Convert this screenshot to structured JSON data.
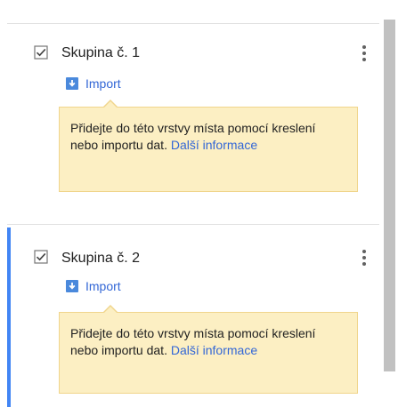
{
  "layers": [
    {
      "title": "Skupina č. 1",
      "checked": true,
      "active": false,
      "import_label": "Import",
      "tip_text": "Přidejte do této vrstvy místa pomocí kreslení nebo importu dat.",
      "tip_link": "Další informace"
    },
    {
      "title": "Skupina č. 2",
      "checked": true,
      "active": true,
      "import_label": "Import",
      "tip_text": "Přidejte do této vrstvy místa pomocí kreslení nebo importu dat.",
      "tip_link": "Další informace"
    }
  ],
  "icons": {
    "checkbox": "checkbox-checked-icon",
    "menu": "more-vert-icon",
    "import": "import-icon"
  },
  "colors": {
    "accent": "#4285f4",
    "link": "#3367d6",
    "tip_background": "#fcefc3",
    "tip_border": "#f0d58c",
    "scrollbar": "#c1c1c1"
  }
}
